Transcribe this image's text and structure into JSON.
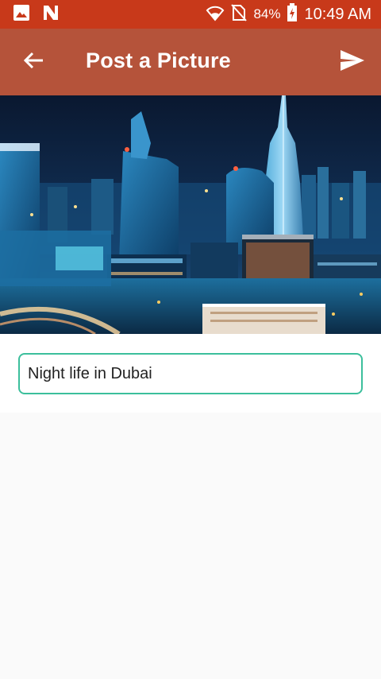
{
  "status_bar": {
    "battery": "84%",
    "time": "10:49 AM",
    "icons": [
      "image-icon",
      "n-logo-icon",
      "wifi-icon",
      "no-sim-icon",
      "battery-charging-icon"
    ]
  },
  "app_bar": {
    "title": "Post a Picture",
    "back_icon": "arrow-back-icon",
    "send_icon": "send-icon"
  },
  "post": {
    "caption": "Night life in Dubai"
  },
  "colors": {
    "status_bar": "#c8391a",
    "app_bar": "#b5533a",
    "input_border": "#3cbf9c",
    "background": "#fafafa"
  }
}
